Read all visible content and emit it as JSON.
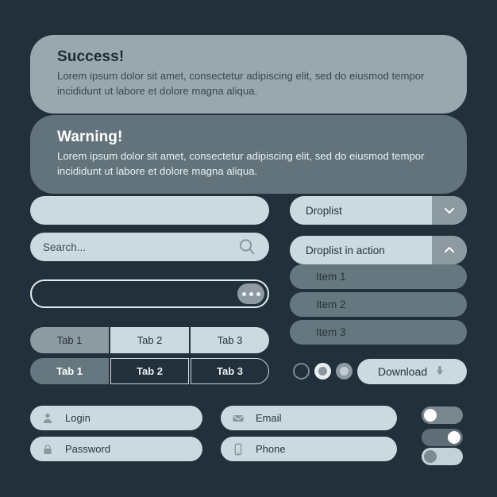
{
  "alerts": [
    {
      "kind": "success",
      "title": "Success!",
      "body": "Lorem ipsum dolor sit amet, consectetur adipiscing elit, sed do eiusmod tempor incididunt ut labore et dolore magna aliqua."
    },
    {
      "kind": "warning",
      "title": "Warning!",
      "body": "Lorem ipsum dolor sit amet, consectetur adipiscing elit, sed do eiusmod tempor incididunt ut labore et dolore magna aliqua."
    }
  ],
  "inputs": {
    "blank_value": "",
    "search_placeholder": "Search...",
    "outlined_value": "",
    "more_button_label": ""
  },
  "tabs_light": [
    {
      "label": "Tab 1",
      "active": true
    },
    {
      "label": "Tab 2",
      "active": false
    },
    {
      "label": "Tab 3",
      "active": false
    }
  ],
  "tabs_outlined": [
    {
      "label": "Tab 1",
      "active": true
    },
    {
      "label": "Tab 2",
      "active": false
    },
    {
      "label": "Tab 3",
      "active": false
    }
  ],
  "droplists": [
    {
      "label": "Droplist",
      "state": "collapsed",
      "chevron": "chevron-down-icon"
    },
    {
      "label": "Droplist in action",
      "state": "expanded",
      "chevron": "chevron-up-icon"
    }
  ],
  "droplist_items": [
    {
      "label": "Item 1"
    },
    {
      "label": "Item 2"
    },
    {
      "label": "Item 3"
    }
  ],
  "radios": [
    {
      "state": "unselected"
    },
    {
      "state": "selected"
    },
    {
      "state": "selected-muted"
    }
  ],
  "download": {
    "label": "Download",
    "icon": "download-arrow-icon"
  },
  "fields": [
    {
      "label": "Login",
      "icon": "user-icon"
    },
    {
      "label": "Password",
      "icon": "lock-icon"
    },
    {
      "label": "Email",
      "icon": "envelope-icon"
    },
    {
      "label": "Phone",
      "icon": "mobile-phone-icon"
    }
  ],
  "toggles": [
    {
      "state": "off"
    },
    {
      "state": "on"
    },
    {
      "state": "off-light"
    }
  ],
  "colors": {
    "background": "#22303b",
    "alert_success_bg": "#9aa7ae",
    "alert_warning_bg": "#62737c",
    "control_light": "#cbd9e1",
    "control_mid": "#8e9aa1",
    "control_slate": "#66787f",
    "text_dark": "#29343c",
    "text_light": "#ffffff"
  }
}
